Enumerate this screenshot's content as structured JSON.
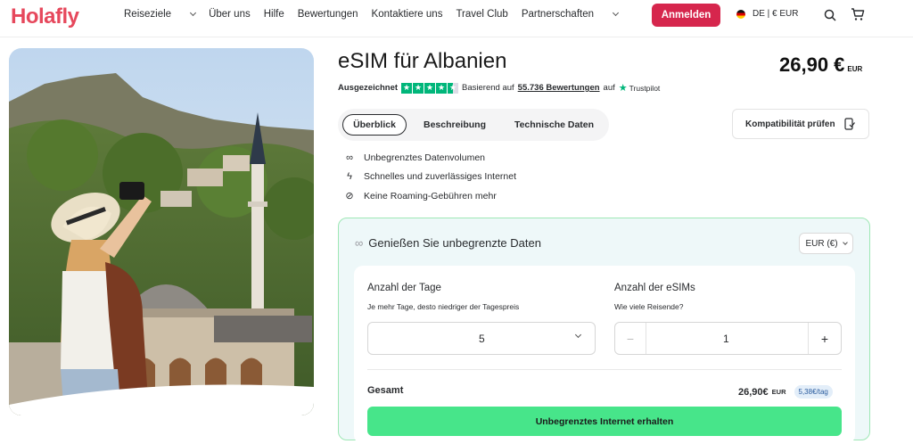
{
  "brand": {
    "logo": "Holafly",
    "color": "#E6485C"
  },
  "nav": {
    "items": [
      {
        "label": "Reiseziele",
        "dropdown": true
      },
      {
        "label": "Über uns",
        "dropdown": false
      },
      {
        "label": "Hilfe",
        "dropdown": false
      },
      {
        "label": "Bewertungen",
        "dropdown": false
      },
      {
        "label": "Kontaktiere uns",
        "dropdown": false
      },
      {
        "label": "Travel Club",
        "dropdown": false
      },
      {
        "label": "Partnerschaften",
        "dropdown": true
      }
    ],
    "login": "Anmelden",
    "language": "DE | € EUR",
    "icons": [
      "search-icon",
      "cart-icon"
    ]
  },
  "product": {
    "title": "eSIM für Albanien",
    "price": "26,90 €",
    "currency": "EUR"
  },
  "rating": {
    "label": "Ausgezeichnet",
    "stars": 4.5,
    "basis": "Basierend auf",
    "count": "55.736 Bewertungen",
    "on": "auf",
    "platform": "Trustpilot"
  },
  "tabs": [
    "Überblick",
    "Beschreibung",
    "Technische Daten"
  ],
  "active_tab": "Überblick",
  "compat_button": "Kompatibilität prüfen",
  "features": [
    {
      "icon": "infinity-icon",
      "text": "Unbegrenztes Datenvolumen"
    },
    {
      "icon": "lightning-icon",
      "text": "Schnelles und zuverlässiges Internet"
    },
    {
      "icon": "no-roaming-icon",
      "text": "Keine Roaming-Gebühren mehr"
    }
  ],
  "plan": {
    "heading": "Genießen Sie unbegrenzte Daten",
    "currency_select": "EUR (€)",
    "days_label": "Anzahl der Tage",
    "days_sub": "Je mehr Tage, desto niedriger der Tagespreis",
    "days_value": "5",
    "esims_label": "Anzahl der eSIMs",
    "esims_sub": "Wie viele Reisende?",
    "esims_value": "1",
    "minus": "−",
    "plus": "+",
    "total_label": "Gesamt",
    "total_value": "26,90€",
    "total_currency": "EUR",
    "per_day": "5,38€/tag",
    "cta": "Unbegrenztes Internet erhalten"
  },
  "colors": {
    "accent": "#D6264D",
    "cta": "#47E58A",
    "trustpilot": "#00B67A",
    "card_border": "#9EE7B5"
  }
}
